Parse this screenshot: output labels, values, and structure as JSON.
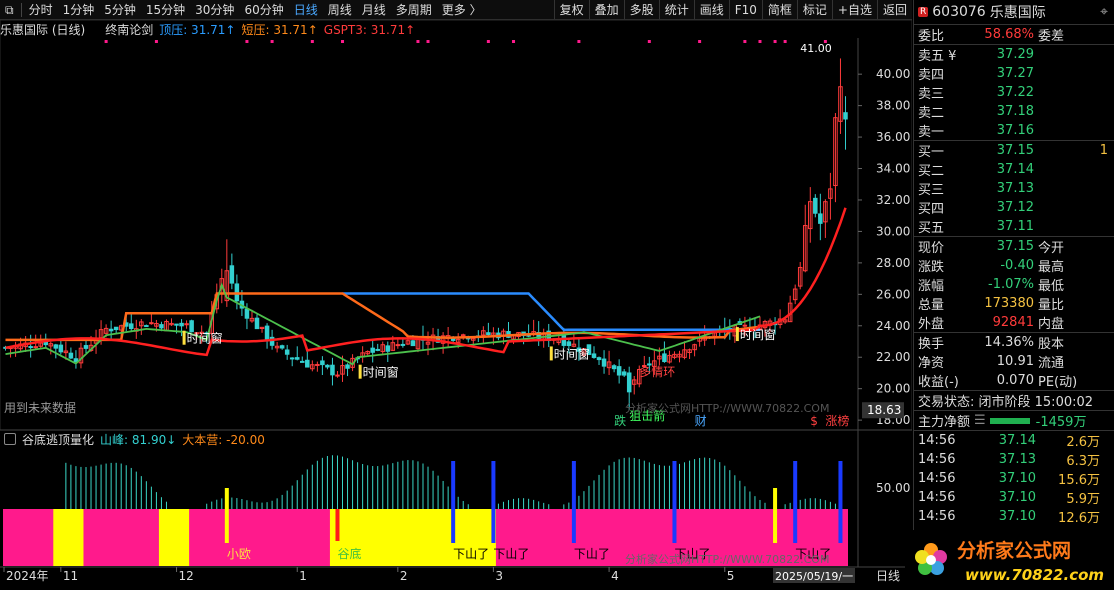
{
  "toolbar": {
    "items": [
      "分时",
      "1分钟",
      "5分钟",
      "15分钟",
      "30分钟",
      "60分钟",
      "日线",
      "周线",
      "月线",
      "多周期",
      "更多 〉"
    ],
    "active": "日线",
    "right_items": [
      "复权",
      "叠加",
      "多股",
      "统计",
      "画线",
      "F10",
      "简框",
      "标记",
      "+自选",
      "返回"
    ]
  },
  "chart_header": {
    "title": "乐惠国际 (日线)",
    "indicator": "终南论剑",
    "top_label": "顶压: 31.71↑",
    "short_label": "短压: 31.71↑",
    "gspt_label": "GSPT3: 31.71↑"
  },
  "sub_header": {
    "title": "谷底逃顶量化",
    "peak_label": "山峰: 81.90↓",
    "camp_label": "大本营: -20.00"
  },
  "colors": {
    "up": "#ff3b3b",
    "down": "#33d0d0",
    "orange": "#ff6a1a",
    "blue": "#2a8cff",
    "green": "#4cc04c",
    "magenta": "#ff1a8c",
    "yellow": "#ffff00"
  },
  "main_chart": {
    "price_axis": [
      "40.00",
      "38.00",
      "36.00",
      "34.00",
      "32.00",
      "30.00",
      "28.00",
      "26.00",
      "24.00",
      "22.00",
      "20.00",
      "18.00"
    ],
    "price_range": [
      17.5,
      42.3
    ],
    "low_box": "18.63",
    "high_label": "41.00",
    "annotations": [
      {
        "text": "时间窗",
        "day": 36
      },
      {
        "text": "时间窗",
        "day": 71
      },
      {
        "text": "时间窗",
        "day": 109
      },
      {
        "text": "时间窗",
        "day": 146
      },
      {
        "text": "多情环",
        "day": 126
      },
      {
        "text": "狙击箭",
        "day": 124
      }
    ],
    "footer_note": "用到未来数据",
    "bottom_tags": [
      {
        "text": "跌",
        "day": 121
      },
      {
        "text": "财",
        "day": 137
      },
      {
        "text": "$",
        "day": 160
      },
      {
        "text": "涨榜",
        "day": 163
      }
    ],
    "watermark": "分析家公式网HTTP://WWW.70822.COM"
  },
  "sub_chart": {
    "axis_label": "50.00",
    "labels": [
      {
        "text": "小欧",
        "day": 44
      },
      {
        "text": "谷底",
        "day": 66
      },
      {
        "text": "下山了",
        "day": 89
      },
      {
        "text": "下山了",
        "day": 97
      },
      {
        "text": "下山了",
        "day": 113
      },
      {
        "text": "下山了",
        "day": 133
      },
      {
        "text": "下山了",
        "day": 157
      }
    ],
    "watermark": "分析家公式网HTTP://WWW.70822.COM"
  },
  "time_axis": {
    "labels": [
      "2024年",
      "11",
      "12",
      "1",
      "2",
      "3",
      "4",
      "5"
    ],
    "cursor_date": "2025/05/19/一",
    "period": "日线"
  },
  "quote_panel": {
    "badge": "R",
    "code": "603076",
    "name": "乐惠国际",
    "weibi_label": "委比",
    "weibi": "58.68%",
    "weicha_label": "委差",
    "asks": [
      {
        "label": "卖五 ¥",
        "price": "37.29",
        "vol": ""
      },
      {
        "label": "卖四",
        "price": "37.27",
        "vol": ""
      },
      {
        "label": "卖三",
        "price": "37.22",
        "vol": ""
      },
      {
        "label": "卖二",
        "price": "37.18",
        "vol": ""
      },
      {
        "label": "卖一",
        "price": "37.16",
        "vol": ""
      }
    ],
    "bids": [
      {
        "label": "买一",
        "price": "37.15",
        "vol": "1"
      },
      {
        "label": "买二",
        "price": "37.14",
        "vol": ""
      },
      {
        "label": "买三",
        "price": "37.13",
        "vol": ""
      },
      {
        "label": "买四",
        "price": "37.12",
        "vol": ""
      },
      {
        "label": "买五",
        "price": "37.11",
        "vol": ""
      }
    ],
    "stats": [
      {
        "l1": "现价",
        "v": "37.15",
        "c": "g",
        "l2": "今开"
      },
      {
        "l1": "涨跌",
        "v": "-0.40",
        "c": "g",
        "l2": "最高"
      },
      {
        "l1": "涨幅",
        "v": "-1.07%",
        "c": "g",
        "l2": "最低"
      },
      {
        "l1": "总量",
        "v": "173380",
        "c": "y",
        "l2": "量比"
      },
      {
        "l1": "外盘",
        "v": "92841",
        "c": "r",
        "l2": "内盘"
      }
    ],
    "stats2": [
      {
        "l1": "换手",
        "v": "14.36%",
        "l2": "股本"
      },
      {
        "l1": "净资",
        "v": "10.91",
        "l2": "流通"
      },
      {
        "l1": "收益(-)",
        "v": "0.070",
        "l2": "PE(动)"
      }
    ],
    "trade_status": "交易状态: 闭市阶段 15:00:02",
    "flow_label": "主力净额",
    "flow_value": "-1459万",
    "ticks": [
      {
        "t": "14:56",
        "p": "37.14",
        "v": "2.6万"
      },
      {
        "t": "14:56",
        "p": "37.13",
        "v": "6.3万"
      },
      {
        "t": "14:56",
        "p": "37.10",
        "v": "15.6万"
      },
      {
        "t": "14:56",
        "p": "37.10",
        "v": "5.9万"
      },
      {
        "t": "14:56",
        "p": "37.10",
        "v": "12.6万"
      }
    ]
  },
  "logo": {
    "title": "分析家公式网",
    "url": "www.70822.com"
  }
}
